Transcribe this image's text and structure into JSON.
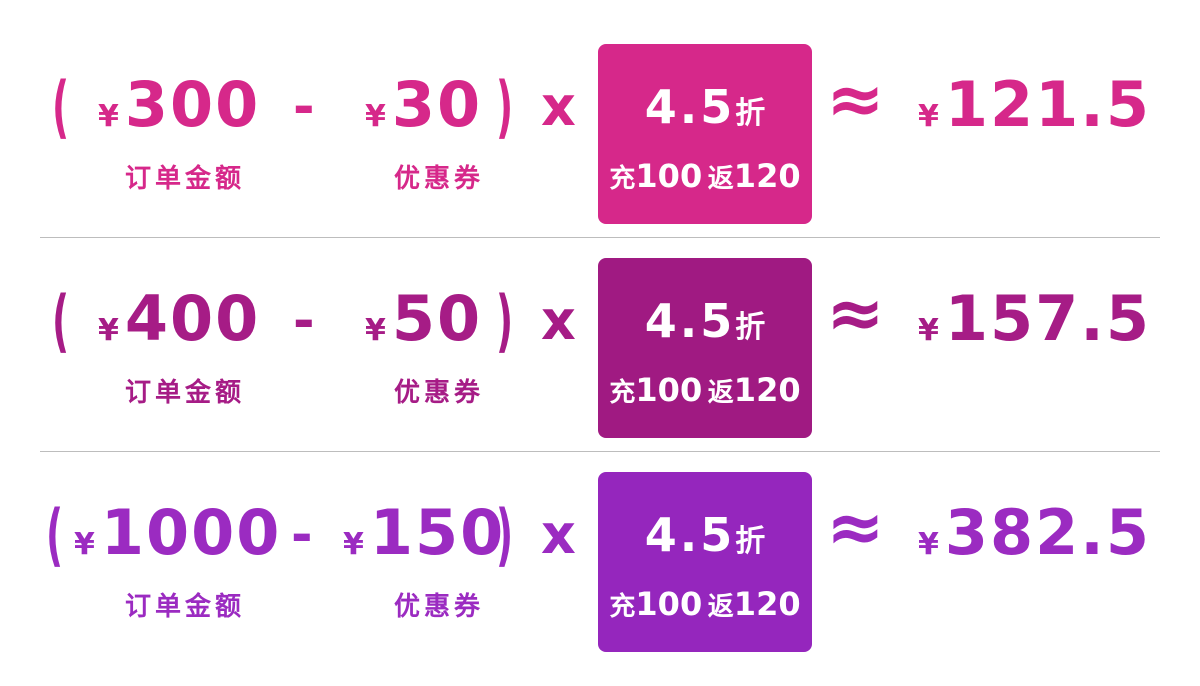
{
  "labels": {
    "order": "订单金额",
    "coupon": "优惠券"
  },
  "symbols": {
    "open": "(",
    "close": ")",
    "minus": "-",
    "times": "x",
    "approx": "≈",
    "yen": "¥"
  },
  "promo_box": {
    "discount": "4.5",
    "discount_unit": "折",
    "charge_label": "充",
    "charge_amount": "100",
    "return_label": "返",
    "return_amount": "120"
  },
  "rows": [
    {
      "order_amount": "300",
      "coupon_amount": "30",
      "result": "121.5",
      "color": "#d6288a",
      "box_color": "#d6288a"
    },
    {
      "order_amount": "400",
      "coupon_amount": "50",
      "result": "157.5",
      "color": "#a61c86",
      "box_color": "#a01a82"
    },
    {
      "order_amount": "1000",
      "coupon_amount": "150",
      "result": "382.5",
      "color": "#9b2bc1",
      "box_color": "#9526bd"
    }
  ]
}
